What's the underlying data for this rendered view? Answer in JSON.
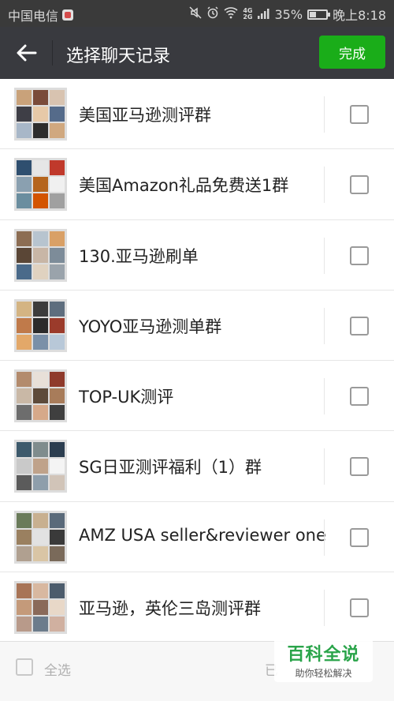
{
  "status_bar": {
    "carrier": "中国电信",
    "network_top": "4G",
    "network_bottom": "2G",
    "battery_percent": "35%",
    "battery_level": 0.35,
    "time": "晚上8:18",
    "icons": [
      "mute-icon",
      "alarm-icon",
      "wifi-icon",
      "signal-icon",
      "battery-icon"
    ]
  },
  "header": {
    "title": "选择聊天记录",
    "done_label": "完成",
    "back_icon": "back-arrow-icon"
  },
  "chats": [
    {
      "name": "美国亚马逊测评群",
      "checked": false
    },
    {
      "name": "美国Amazon礼品免费送1群",
      "checked": false
    },
    {
      "name": "130.亚马逊刷单",
      "checked": false
    },
    {
      "name": "YOYO亚马逊测单群",
      "checked": false
    },
    {
      "name": "TOP-UK测评",
      "checked": false
    },
    {
      "name": "SG日亚测评福利（1）群",
      "checked": false
    },
    {
      "name": "AMZ USA seller&reviewer one",
      "checked": false
    },
    {
      "name": "亚马逊，英伦三岛测评群",
      "checked": false
    }
  ],
  "bottom_bar": {
    "select_all_label": "全选",
    "selected_count_label": "已"
  },
  "watermark": {
    "title": "百科全说",
    "subtitle": "助你轻松解决"
  },
  "colors": {
    "header_bg": "#393a3f",
    "status_bg": "#3a3a3a",
    "accent_green": "#1aad19",
    "watermark_green": "#2aa44a"
  }
}
